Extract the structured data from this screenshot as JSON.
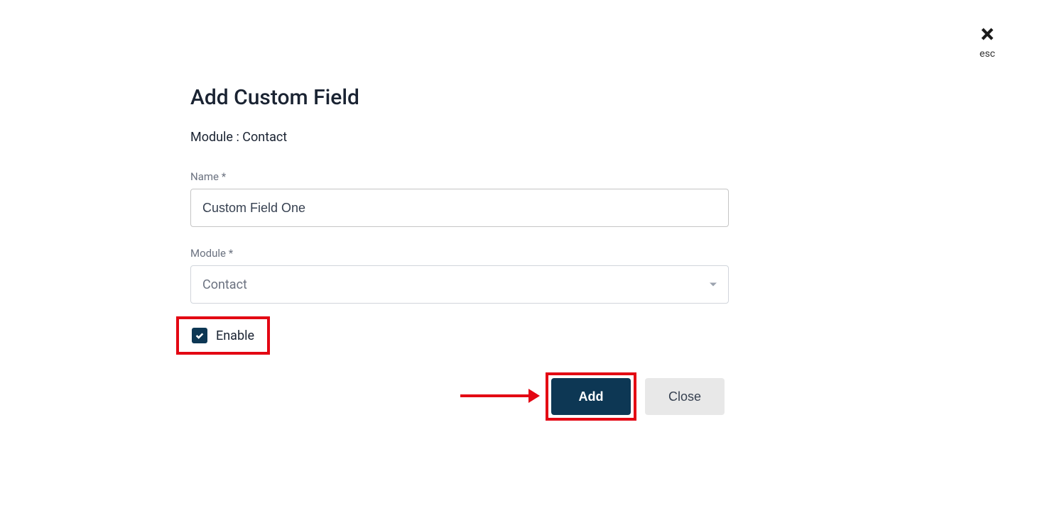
{
  "close": {
    "icon": "×",
    "label": "esc"
  },
  "modal": {
    "title": "Add Custom Field",
    "module_info": "Module : Contact",
    "fields": {
      "name": {
        "label": "Name *",
        "value": "Custom Field One"
      },
      "module": {
        "label": "Module *",
        "selected": "Contact"
      },
      "enable": {
        "label": "Enable",
        "checked": true
      }
    },
    "buttons": {
      "add": "Add",
      "close": "Close"
    }
  }
}
